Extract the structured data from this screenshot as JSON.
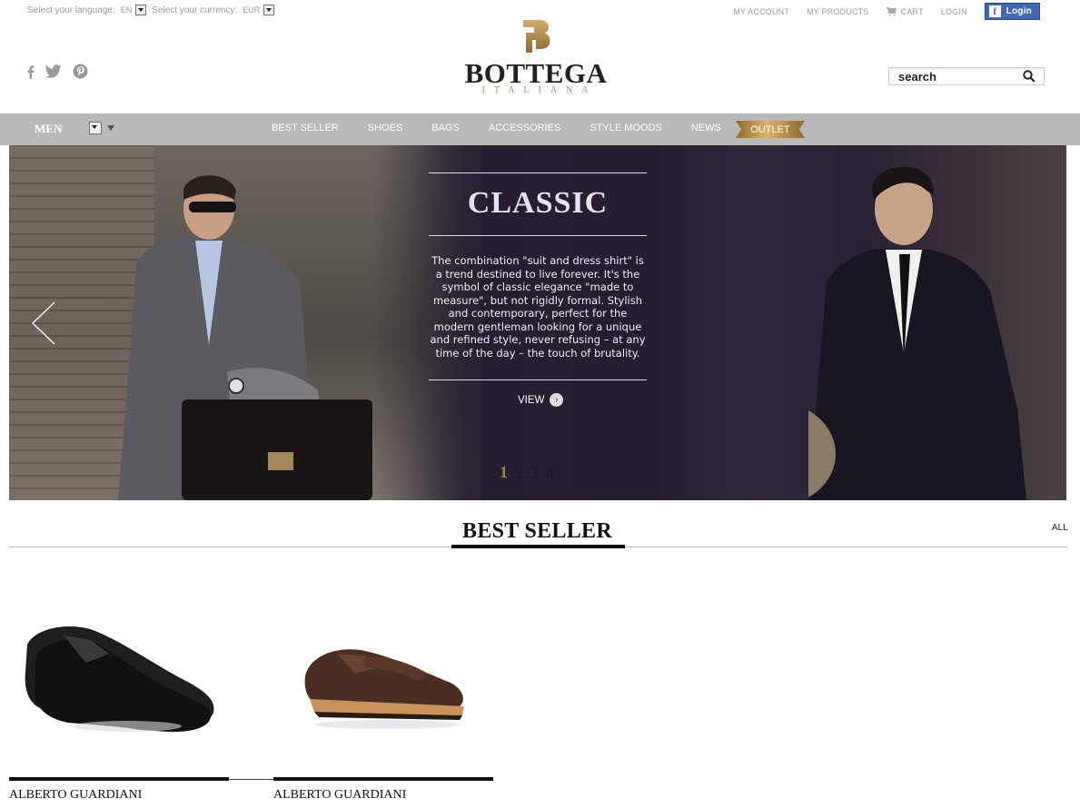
{
  "topbar": {
    "language_label": "Select your language:",
    "language_value": "EN",
    "currency_label": "Select your currency:",
    "currency_value": "EUR",
    "my_account": "MY ACCOUNT",
    "my_products": "MY PRODUCTS",
    "cart": "CART",
    "login": "LOGIN",
    "fb_login": "Login"
  },
  "header": {
    "logo_name": "BOTTEGA",
    "logo_sub": "ITALIANA",
    "search_placeholder": "search"
  },
  "nav": {
    "gender": "MEN",
    "items": [
      "BEST SELLER",
      "SHOES",
      "BAGS",
      "ACCESSORIES",
      "STYLE MOODS",
      "NEWS"
    ],
    "outlet": "OUTLET"
  },
  "hero": {
    "title": "CLASSIC",
    "text": "The combination \"suit and dress shirt\" is a trend destined to live forever. It's the symbol of classic elegance \"made to measure\", but not rigidly formal. Stylish and contemporary, perfect for the modern gentleman looking for a unique and refined style, never refusing  – at any time of the day – the touch of brutality.",
    "view": "VIEW",
    "slides": [
      "1",
      "2",
      "3",
      "4"
    ],
    "active_slide": "1"
  },
  "best_seller": {
    "title": "BEST SELLER",
    "all_link": "ALL",
    "products": [
      {
        "name": "ALBERTO GUARDIANI",
        "image": "black-leather-derby-shoes"
      },
      {
        "name": "ALBERTO GUARDIANI",
        "image": "brown-suede-brogue-shoes"
      }
    ]
  },
  "colors": {
    "nav_bg": "#b9b9b9",
    "gold": "#b48b4d",
    "facebook": "#4267b2"
  }
}
